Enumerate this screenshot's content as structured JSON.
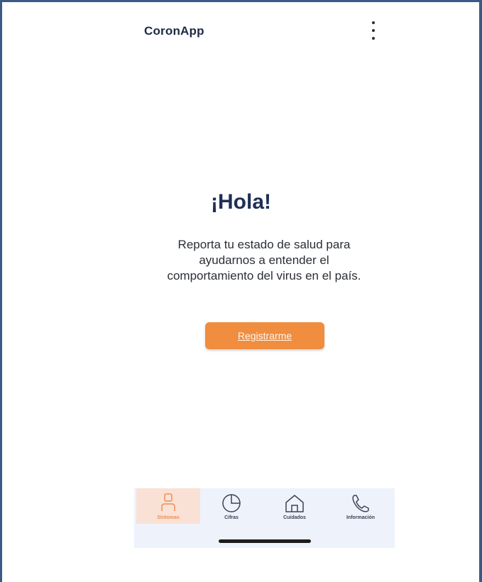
{
  "header": {
    "app_title": "CoronApp",
    "menu_icon": "more-vert-icon"
  },
  "main": {
    "greeting": "¡Hola!",
    "message": "Reporta tu estado de salud para ayudarnos a entender el comportamiento del virus en el país.",
    "register_button_label": "Registrarme"
  },
  "bottom_nav": {
    "items": [
      {
        "label": "Síntomas",
        "icon": "person-icon",
        "active": true
      },
      {
        "label": "Cifras",
        "icon": "pie-chart-icon",
        "active": false
      },
      {
        "label": "Cuidados",
        "icon": "home-icon",
        "active": false
      },
      {
        "label": "Información",
        "icon": "phone-icon",
        "active": false
      }
    ]
  },
  "colors": {
    "accent": "#f08d3f",
    "nav_background": "#eef2fb",
    "active_tab_background": "#f9e1d5",
    "frame_border": "#3b5b86",
    "title_text": "#1f2f57"
  }
}
